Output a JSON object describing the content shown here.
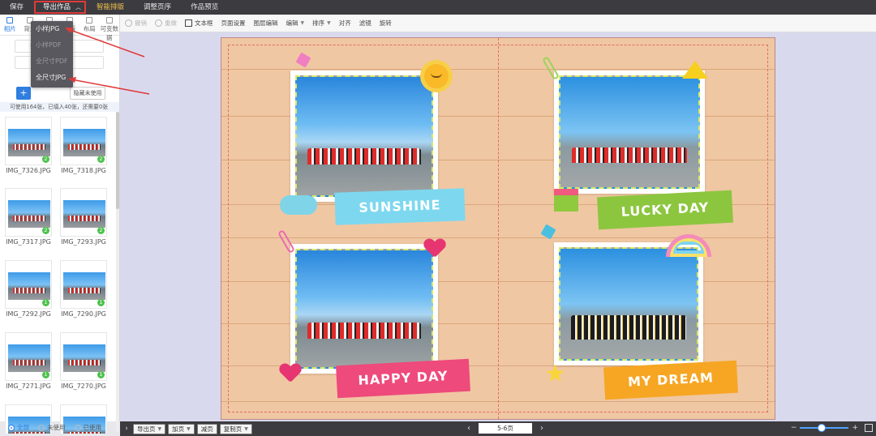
{
  "menu": {
    "save": "保存",
    "export": "导出作品",
    "smart_layout": "智能排版",
    "adjust_pages": "调整页序",
    "preview": "作品预览"
  },
  "export_menu": {
    "options": [
      {
        "label": "小样JPG",
        "enabled": true
      },
      {
        "label": "小样PDF",
        "enabled": false
      },
      {
        "label": "全尺寸PDF",
        "enabled": false
      },
      {
        "label": "全尺寸JPG",
        "enabled": true
      }
    ]
  },
  "toolbar": {
    "undo": "撤销",
    "redo": "重做",
    "textbox": "文本框",
    "page_settings": "页面设置",
    "layer_edit": "图层编辑",
    "edit": "编辑",
    "sort": "排序",
    "align": "对齐",
    "filter": "滤镜",
    "rotate": "旋转"
  },
  "left_panel": {
    "tabs": [
      "相片",
      "背景",
      "装饰",
      "模板",
      "布局",
      "可变数据"
    ],
    "active_tab": 0,
    "select_placeholder": "照片",
    "search_placeholder": "搜",
    "add_button": "+",
    "hide_used": "隐藏未使用",
    "usage": "可使用164张，已填入40张，还需要0张",
    "thumbnails": [
      {
        "name": "IMG_7326.JPG",
        "count": "2"
      },
      {
        "name": "IMG_7318.JPG",
        "count": "2"
      },
      {
        "name": "IMG_7317.JPG",
        "count": "2"
      },
      {
        "name": "IMG_7293.JPG",
        "count": "2"
      },
      {
        "name": "IMG_7292.JPG",
        "count": "1"
      },
      {
        "name": "IMG_7290.JPG",
        "count": "1"
      },
      {
        "name": "IMG_7271.JPG",
        "count": "1"
      },
      {
        "name": "IMG_7270.JPG",
        "count": "1"
      }
    ],
    "filters": [
      {
        "label": "全部",
        "selected": true
      },
      {
        "label": "未使用",
        "selected": false
      },
      {
        "label": "已使用",
        "selected": false
      }
    ]
  },
  "canvas": {
    "labels": {
      "sunshine": "SUNSHINE",
      "lucky_day": "LUCKY DAY",
      "happy_day": "HAPPY DAY",
      "my_dream": "MY DREAM"
    },
    "colors": {
      "sunshine": "#7dd8ef",
      "lucky_day": "#8cc63f",
      "happy_day": "#ee4a7c",
      "my_dream": "#f6a623",
      "board": "#f0c7a3"
    }
  },
  "bottom": {
    "export_page": "导出页",
    "add_page": "加页",
    "delete_page": "减页",
    "copy_page": "复制页",
    "page_indicator": "5-6页",
    "zoom_minus": "−",
    "zoom_plus": "+",
    "zoom_level": 0.45
  },
  "accent": "#2f7ee0",
  "highlight": "#e03a3a"
}
